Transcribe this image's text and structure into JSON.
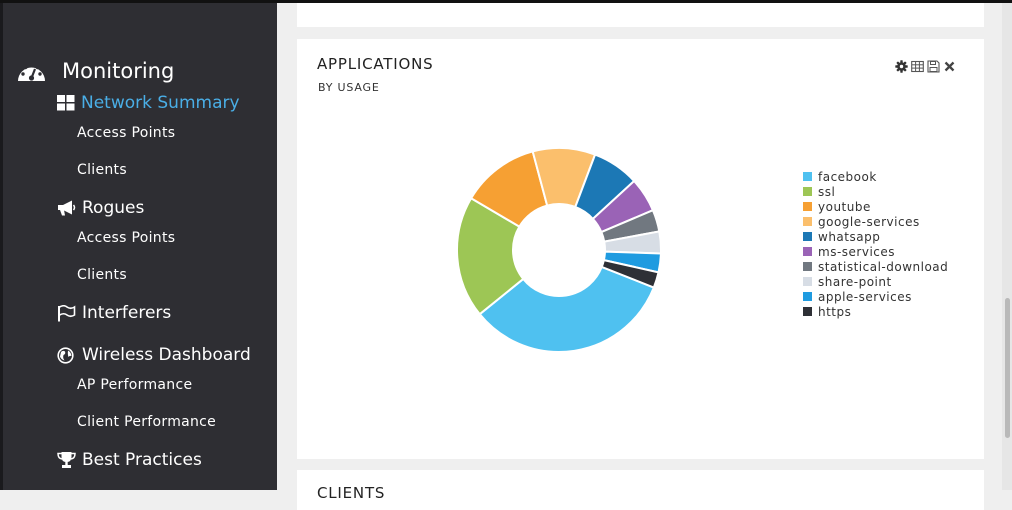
{
  "sidebar": {
    "section_title": "Monitoring",
    "items": [
      {
        "type": "head",
        "label": "Network Summary",
        "icon": "grid-icon",
        "active": true
      },
      {
        "type": "sub",
        "label": "Access Points"
      },
      {
        "type": "sub",
        "label": "Clients"
      },
      {
        "type": "head",
        "label": "Rogues",
        "icon": "megaphone-icon"
      },
      {
        "type": "sub",
        "label": "Access Points"
      },
      {
        "type": "sub",
        "label": "Clients"
      },
      {
        "type": "head",
        "label": "Interferers",
        "icon": "flag-icon"
      },
      {
        "type": "head",
        "label": "Wireless Dashboard",
        "icon": "globe-icon"
      },
      {
        "type": "sub",
        "label": "AP Performance"
      },
      {
        "type": "sub",
        "label": "Client Performance"
      },
      {
        "type": "head",
        "label": "Best Practices",
        "icon": "trophy-icon"
      }
    ]
  },
  "card": {
    "title": "APPLICATIONS",
    "subtitle": "BY USAGE",
    "tools": [
      "gear-icon",
      "table-icon",
      "save-icon",
      "close-icon"
    ]
  },
  "next_card": {
    "title": "CLIENTS"
  },
  "chart_data": {
    "type": "pie",
    "donut": true,
    "legend_position": "right",
    "slices": [
      {
        "label": "facebook",
        "value": 33.5,
        "color": "#4fc1f0"
      },
      {
        "label": "ssl",
        "value": 19.5,
        "color": "#9dc655"
      },
      {
        "label": "youtube",
        "value": 12.5,
        "color": "#f6a033"
      },
      {
        "label": "google-services",
        "value": 10.0,
        "color": "#fbbf6c"
      },
      {
        "label": "whatsapp",
        "value": 7.5,
        "color": "#1c78b5"
      },
      {
        "label": "ms-services",
        "value": 5.5,
        "color": "#9a63b6"
      },
      {
        "label": "statistical-download",
        "value": 3.5,
        "color": "#717880"
      },
      {
        "label": "share-point",
        "value": 3.5,
        "color": "#d7dde5"
      },
      {
        "label": "apple-services",
        "value": 3.0,
        "color": "#1f9be0"
      },
      {
        "label": "https",
        "value": 2.5,
        "color": "#2e3036"
      }
    ]
  }
}
